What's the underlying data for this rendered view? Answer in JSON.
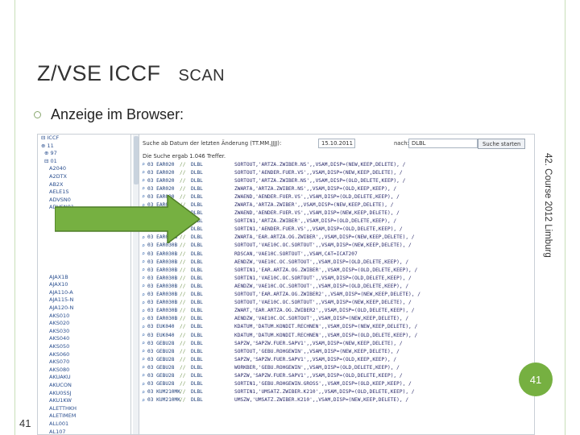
{
  "slide": {
    "title_main": "Z/VSE ICCF",
    "title_scan": "SCAN",
    "bullet": "Anzeige im Browser:",
    "footer_vertical": "42. Course 2012 Limburg",
    "page_number": "41",
    "accent_color": "#76b041"
  },
  "browser": {
    "search_label": "Suche ab Datum der letzten Änderung (TT.MM.JJJJ):",
    "date_value": "15.10.2011",
    "name_label": "nach:",
    "name_value": "DLBL",
    "search_button": "Suche starten",
    "hits_text": "Die Suche ergab 1.046 Treffer.",
    "tree": [
      "⊟ ICCF",
      "⊕ 11",
      "⊕ 97",
      "⊟ 01",
      "A2040",
      "A2DTX",
      "AB2X",
      "AELE1S",
      "ADVSN0",
      "ADVSN01",
      "",
      "",
      "",
      "",
      "",
      "",
      "",
      "",
      "AJAX1B",
      "AJAX10",
      "AJA110-A",
      "AJA115-N",
      "AJA120-N",
      "AKS010",
      "AKS020",
      "AKS030",
      "AKS040",
      "AKS050",
      "AKS060",
      "AKS070",
      "AKS080",
      "AKUAKU",
      "AKUCON",
      "AKU0SSJ",
      "AKU1KW",
      "ALETTHKH",
      "ALETIMEM",
      "ALL001",
      "AL107"
    ],
    "rows": [
      {
        "date": "03 EAR020",
        "name": "DLBL",
        "def": "SORTOUT,'ARTZA.ZWIBER.NS',,VSAM,DISP=(NEW,KEEP,DELETE), /"
      },
      {
        "date": "03 EAR020",
        "name": "DLBL",
        "def": "SORTOUT,'AENDER.FUER.VS',,VSAM,DISP=(NEW,KEEP,DELETE), /"
      },
      {
        "date": "03 EAR020",
        "name": "DLBL",
        "def": "SORTOUT,'ARTZA.ZWIBER.NS',,VSAM,DISP=(OLD,DELETE,KEEP), /"
      },
      {
        "date": "03 EAR020",
        "name": "DLBL",
        "def": "ZWARTA,'ARTZA.ZWIBER.NS',,VSAM,DISP=(OLD,KEEP,KEEP), /"
      },
      {
        "date": "03 EAR020",
        "name": "DLBL",
        "def": "ZWAEND,'AENDER.FUER.VS',,VSAM,DISP=(OLD,DELETE,KEEP), /"
      },
      {
        "date": "03 EAR020",
        "name": "DLBL",
        "def": "ZWARTA,'ARTZA.ZWIBER',,VSAM,DISP=(NEW,KEEP,DELETE), /"
      },
      {
        "date": "03 EAR020",
        "name": "DLBL",
        "def": "ZWAEND,'AENDER.FUER.VS',,VSAM,DISP=(NEW,KEEP,DELETE), /"
      },
      {
        "date": "03 EAR020",
        "name": "DLBL",
        "def": "SORTIN1,'ARTZA.ZWIBER',,VSAM,DISP=(OLD,DELETE,KEEP), /"
      },
      {
        "date": "03 EAR020",
        "name": "DLBL",
        "def": "SORTIN1,'AENDER.FUER.VS',,VSAM,DISP=(OLD,DELETE,KEEP), /"
      },
      {
        "date": "03 EAR030B",
        "name": "DLBL",
        "def": "ZWARTA,'EAR.ARTZA.OG.ZWIBER',,VSAM,DISP=(NEW,KEEP,DELETE), /"
      },
      {
        "date": "03 EAR030B",
        "name": "DLBL",
        "def": "SORTOUT,'VAE10C.OC.SORTOUT',,VSAM,DISP=(NEW,KEEP,DELETE), /"
      },
      {
        "date": "03 EAR030B",
        "name": "DLBL",
        "def": "RDSCAN,'VAE10C.SORTOUT',,VSAM,CAT=ICAT207"
      },
      {
        "date": "03 EAR030B",
        "name": "DLBL",
        "def": "AENDZW,'VAE10C.OC.SORTOUT',,VSAM,DISP=(OLD,DELETE,KEEP), /"
      },
      {
        "date": "03 EAR030B",
        "name": "DLBL",
        "def": "SORTIN1,'EAR.ARTZA.OG.ZWIBER',,VSAM,DISP=(OLD,DELETE,KEEP), /"
      },
      {
        "date": "03 EAR030B",
        "name": "DLBL",
        "def": "SORTIN1,'VAE10C.OC.SORTOUT',,VSAM,DISP=(OLD,DELETE,KEEP), /"
      },
      {
        "date": "03 EAR030B",
        "name": "DLBL",
        "def": "AENDZW,'VAE10C.OC.SORTOUT',,VSAM,DISP=(OLD,DELETE,KEEP), /"
      },
      {
        "date": "03 EAR030B",
        "name": "DLBL",
        "def": "SORTOUT,'EAR.ARTZA.OG.ZWIBER2',,VSAM,DISP=(NEW,KEEP,DELETE), /"
      },
      {
        "date": "03 EAR030B",
        "name": "DLBL",
        "def": "SORTOUT,'VAE10C.OC.SORTOUT',,VSAM,DISP=(NEW,KEEP,DELETE), /"
      },
      {
        "date": "03 EAR030B",
        "name": "DLBL",
        "def": "ZWART,'EAR.ARTZA.OG.ZWIBER2',,VSAM,DISP=(OLD,DELETE,KEEP), /"
      },
      {
        "date": "03 EAR030B",
        "name": "DLBL",
        "def": "AENDZW,'VAE10C.OC.SORTOUT',,VSAM,DISP=(NEW,KEEP,DELETE), /"
      },
      {
        "date": "03 EUK040",
        "name": "DLBL",
        "def": "KDATUM,'DATUM.KONDIT.RECHNEN',,VSAM,DISP=(NEW,KEEP,DELETE), /"
      },
      {
        "date": "03 EUK040",
        "name": "DLBL",
        "def": "KDATUM,'DATUM.KONDIT.RECHNEN',,VSAM,DISP=(OLD,DELETE,KEEP), /"
      },
      {
        "date": "03 GEBU28",
        "name": "DLBL",
        "def": "SAPZW,'SAPZW.FUER.SAPV1',,VSAM,DISP=(NEW,KEEP,DELETE), /"
      },
      {
        "date": "03 GEBU28",
        "name": "DLBL",
        "def": "SORTOUT,'GEBU.ROHGEWIN',,VSAM,DISP=(NEW,KEEP,DELETE), /"
      },
      {
        "date": "03 GEBU28",
        "name": "DLBL",
        "def": "SAPZW,'SAPZW.FUER.SAPV1',,VSAM,DISP=(OLD,KEEP,KEEP), /"
      },
      {
        "date": "03 GEBU28",
        "name": "DLBL",
        "def": "WORKBER,'GEBU.ROHGEWIN',,VSAM,DISP=(OLD,DELETE,KEEP), /"
      },
      {
        "date": "03 GEBU28",
        "name": "DLBL",
        "def": "SAPZW,'SAPZW.FUER.SAPV1',,VSAM,DISP=(OLD,DELETE,KEEP), /"
      },
      {
        "date": "03 GEBU28",
        "name": "DLBL",
        "def": "SORTIN1,'GEBU.ROHGEWIN.GROSS',,VSAM,DISP=(OLD,KEEP,KEEP), /"
      },
      {
        "date": "03 KUM210MK",
        "name": "DLBL",
        "def": "SORTIN1,'UMSATZ.ZWIBER.K210',,VSAM,DISP=(OLD,DELETE,KEEP), /"
      },
      {
        "date": "03 KUM210MK",
        "name": "DLBL",
        "def": "UMSZW,'UMSATZ.ZWIBER.K210',,VSAM,DISP=(NEW,KEEP,DELETE), /"
      }
    ]
  }
}
